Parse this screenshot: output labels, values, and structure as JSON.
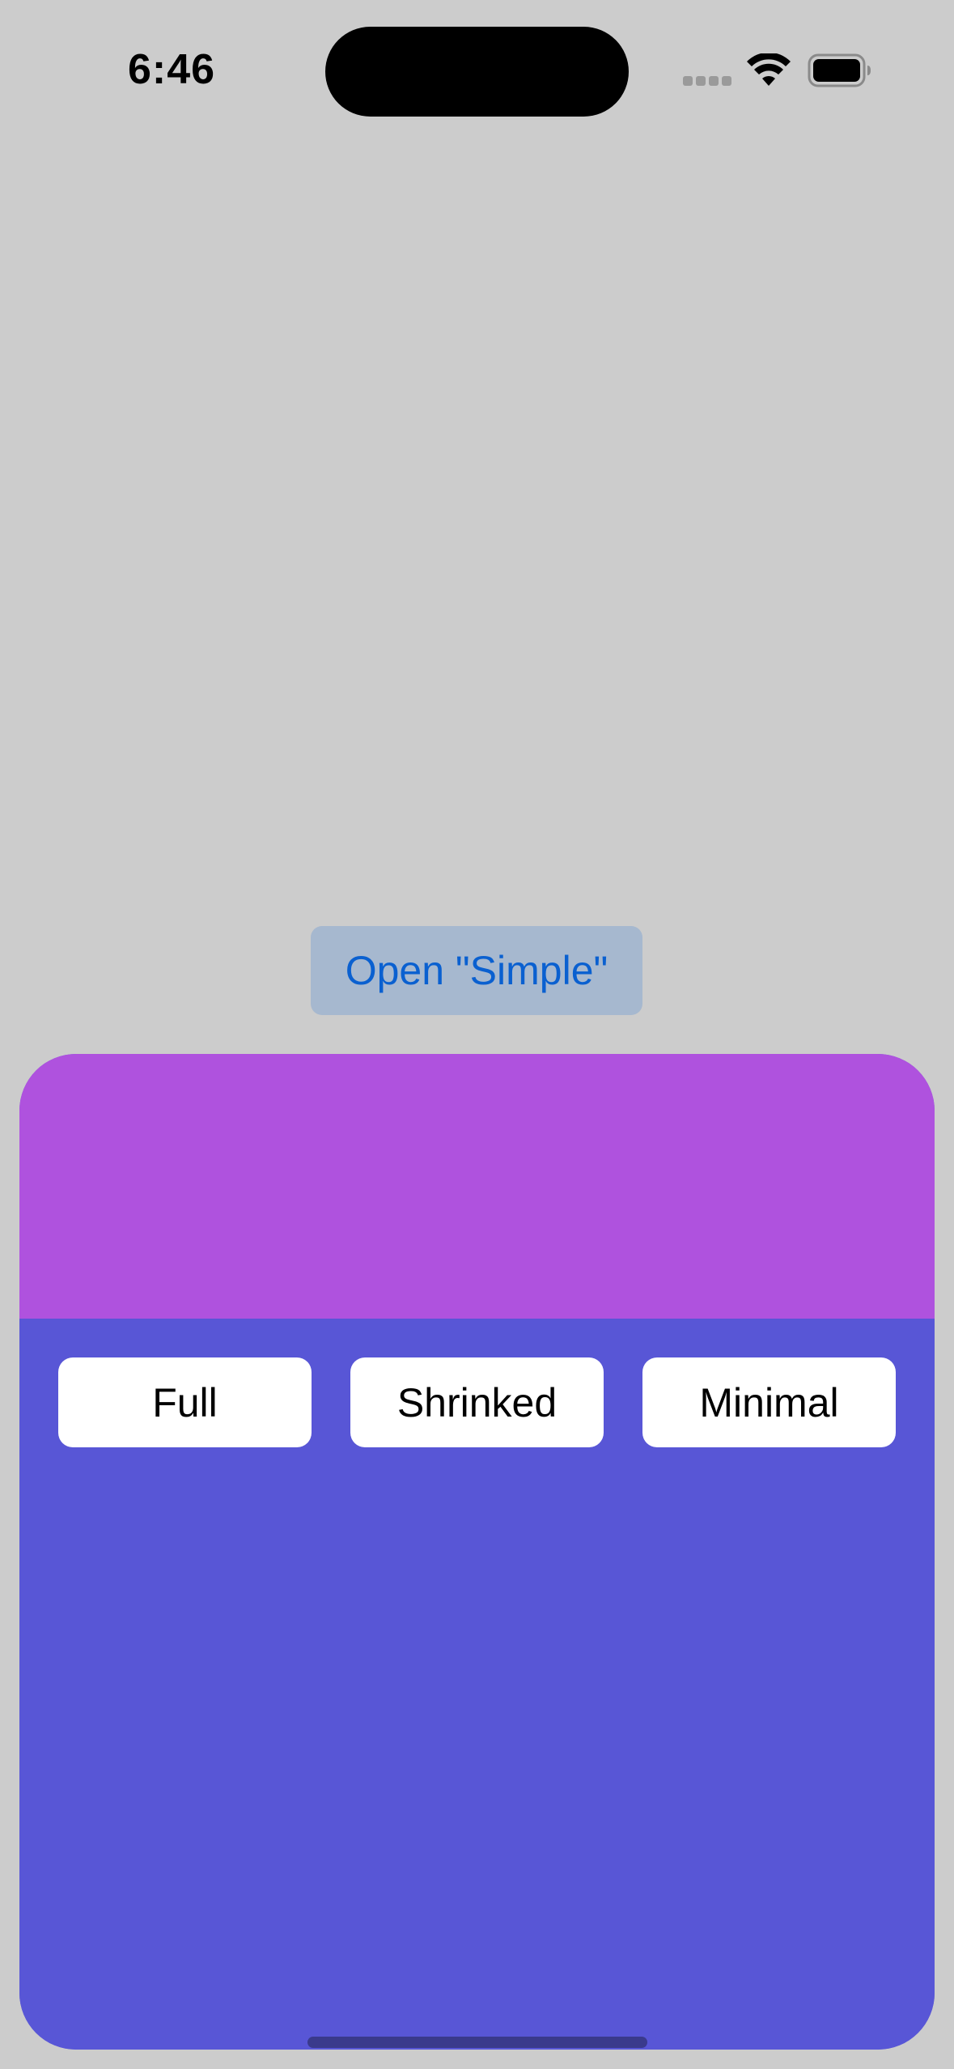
{
  "status_bar": {
    "time": "6:46",
    "icons": [
      "signal-icon",
      "wifi-icon",
      "battery-icon"
    ]
  },
  "main": {
    "open_button_label": "Open \"Simple\""
  },
  "sheet": {
    "colors": {
      "header": "#af52de",
      "body": "#5856d6"
    },
    "buttons": {
      "full": "Full",
      "shrinked": "Shrinked",
      "minimal": "Minimal"
    }
  },
  "colors": {
    "background": "#cccccc",
    "accent": "#0a60d0"
  }
}
